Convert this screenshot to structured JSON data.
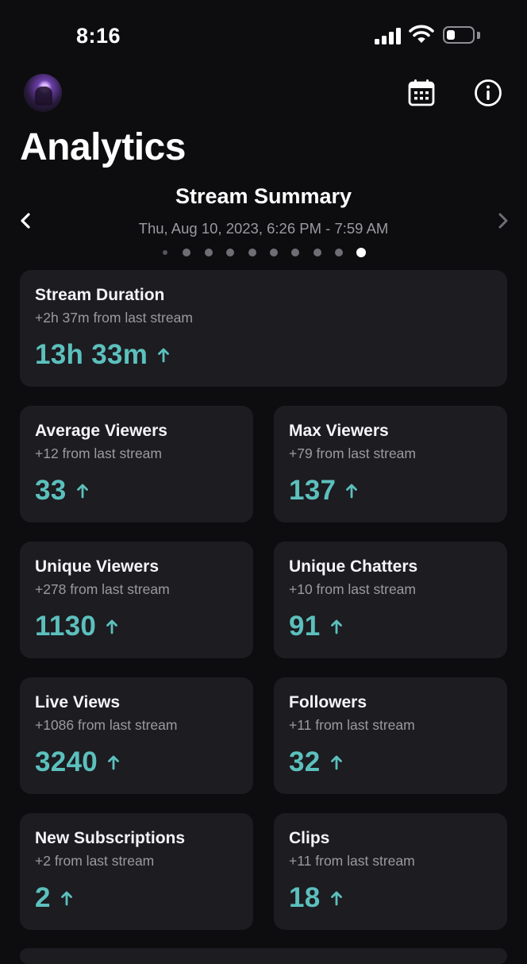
{
  "status_bar": {
    "time": "8:16"
  },
  "header": {
    "title": "Analytics"
  },
  "summary": {
    "title": "Stream Summary",
    "date_range": "Thu, Aug 10, 2023, 6:26 PM - 7:59 AM",
    "page_count": 10,
    "active_page": 10
  },
  "cards": {
    "stream_duration": {
      "label": "Stream Duration",
      "sub": "+2h 37m from last stream",
      "value": "13h 33m"
    },
    "average_viewers": {
      "label": "Average Viewers",
      "sub": "+12 from last stream",
      "value": "33"
    },
    "max_viewers": {
      "label": "Max Viewers",
      "sub": "+79 from last stream",
      "value": "137"
    },
    "unique_viewers": {
      "label": "Unique Viewers",
      "sub": "+278 from last stream",
      "value": "1130"
    },
    "unique_chatters": {
      "label": "Unique Chatters",
      "sub": "+10 from last stream",
      "value": "91"
    },
    "live_views": {
      "label": "Live Views",
      "sub": "+1086 from last stream",
      "value": "3240"
    },
    "followers": {
      "label": "Followers",
      "sub": "+11 from last stream",
      "value": "32"
    },
    "new_subscriptions": {
      "label": "New Subscriptions",
      "sub": "+2 from last stream",
      "value": "2"
    },
    "clips": {
      "label": "Clips",
      "sub": "+11 from last stream",
      "value": "18"
    }
  },
  "icons": {
    "trend": "arrow-up-icon",
    "calendar": "calendar-icon",
    "info": "info-icon",
    "prev": "chevron-left-icon",
    "next": "chevron-right-icon"
  },
  "colors": {
    "accent": "#5cc0bd",
    "background": "#0d0d0f",
    "card": "#1c1c21",
    "muted": "#9a9aa0"
  },
  "battery_level": 0.3
}
